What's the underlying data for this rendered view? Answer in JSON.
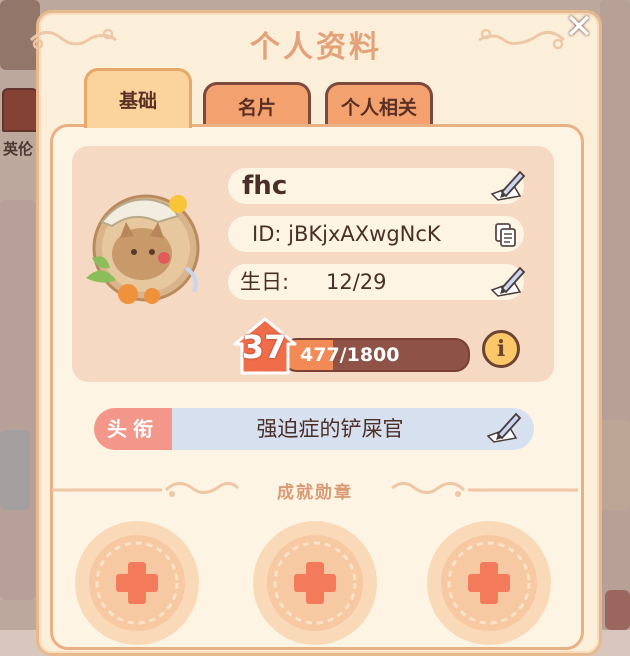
{
  "background": {
    "left_label": "英伦"
  },
  "panel": {
    "title": "个人资料"
  },
  "tabs": [
    {
      "label": "基础",
      "active": true
    },
    {
      "label": "名片",
      "active": false
    },
    {
      "label": "个人相关",
      "active": false
    }
  ],
  "profile": {
    "name": "fhc",
    "id_text": "ID: jBKjxAXwgNcK",
    "birthday_label": "生日:",
    "birthday_value": "12/29",
    "level": "37",
    "xp_text": "477/1800",
    "xp_fraction": 0.265
  },
  "honor": {
    "label": "头衔",
    "value": "强迫症的铲屎官"
  },
  "badges": {
    "title": "成就勋章",
    "slots": 3
  },
  "colors": {
    "accent": "#f18a55",
    "panel": "#fcefd9",
    "card": "#f6d9c3",
    "honor_label": "#f2978a",
    "honor_value": "#d7e0ef"
  },
  "icons": [
    "close-icon",
    "edit-icon",
    "copy-icon",
    "info-icon",
    "plus-icon",
    "level-house-icon"
  ]
}
